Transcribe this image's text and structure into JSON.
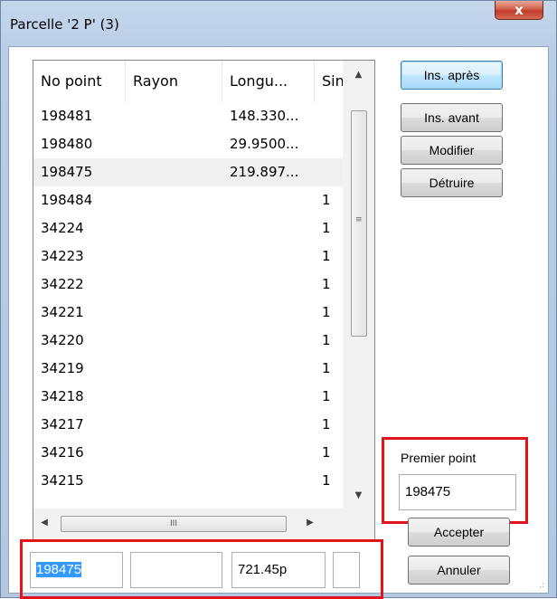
{
  "window": {
    "title": "Parcelle '2 P' (3)",
    "close_label": "x"
  },
  "table": {
    "columns": [
      "No point",
      "Rayon",
      "Longu...",
      "Sin"
    ],
    "rows": [
      {
        "no": "198481",
        "rayon": "",
        "longueur": "148.330...",
        "sin": ""
      },
      {
        "no": "198480",
        "rayon": "",
        "longueur": "29.9500...",
        "sin": ""
      },
      {
        "no": "198475",
        "rayon": "",
        "longueur": "219.897...",
        "sin": ""
      },
      {
        "no": "198484",
        "rayon": "",
        "longueur": "",
        "sin": "1"
      },
      {
        "no": "34224",
        "rayon": "",
        "longueur": "",
        "sin": "1"
      },
      {
        "no": "34223",
        "rayon": "",
        "longueur": "",
        "sin": "1"
      },
      {
        "no": "34222",
        "rayon": "",
        "longueur": "",
        "sin": "1"
      },
      {
        "no": "34221",
        "rayon": "",
        "longueur": "",
        "sin": "1"
      },
      {
        "no": "34220",
        "rayon": "",
        "longueur": "",
        "sin": "1"
      },
      {
        "no": "34219",
        "rayon": "",
        "longueur": "",
        "sin": "1"
      },
      {
        "no": "34218",
        "rayon": "",
        "longueur": "",
        "sin": "1"
      },
      {
        "no": "34217",
        "rayon": "",
        "longueur": "",
        "sin": "1"
      },
      {
        "no": "34216",
        "rayon": "",
        "longueur": "",
        "sin": "1"
      },
      {
        "no": "34215",
        "rayon": "",
        "longueur": "",
        "sin": "1"
      }
    ],
    "selected_row": 2,
    "hscroll_grip": "III"
  },
  "buttons": {
    "ins_apres": "Ins. après",
    "ins_avant": "Ins. avant",
    "modifier": "Modifier",
    "detruire": "Détruire",
    "accepter": "Accepter",
    "annuler": "Annuler"
  },
  "premier_point": {
    "label": "Premier point",
    "value": "198475"
  },
  "edit_row": {
    "no": "198475",
    "rayon": "",
    "longueur": "721.45p",
    "sin": ""
  },
  "colors": {
    "highlight_border": "#e0141e",
    "selection": "#3399ff"
  }
}
